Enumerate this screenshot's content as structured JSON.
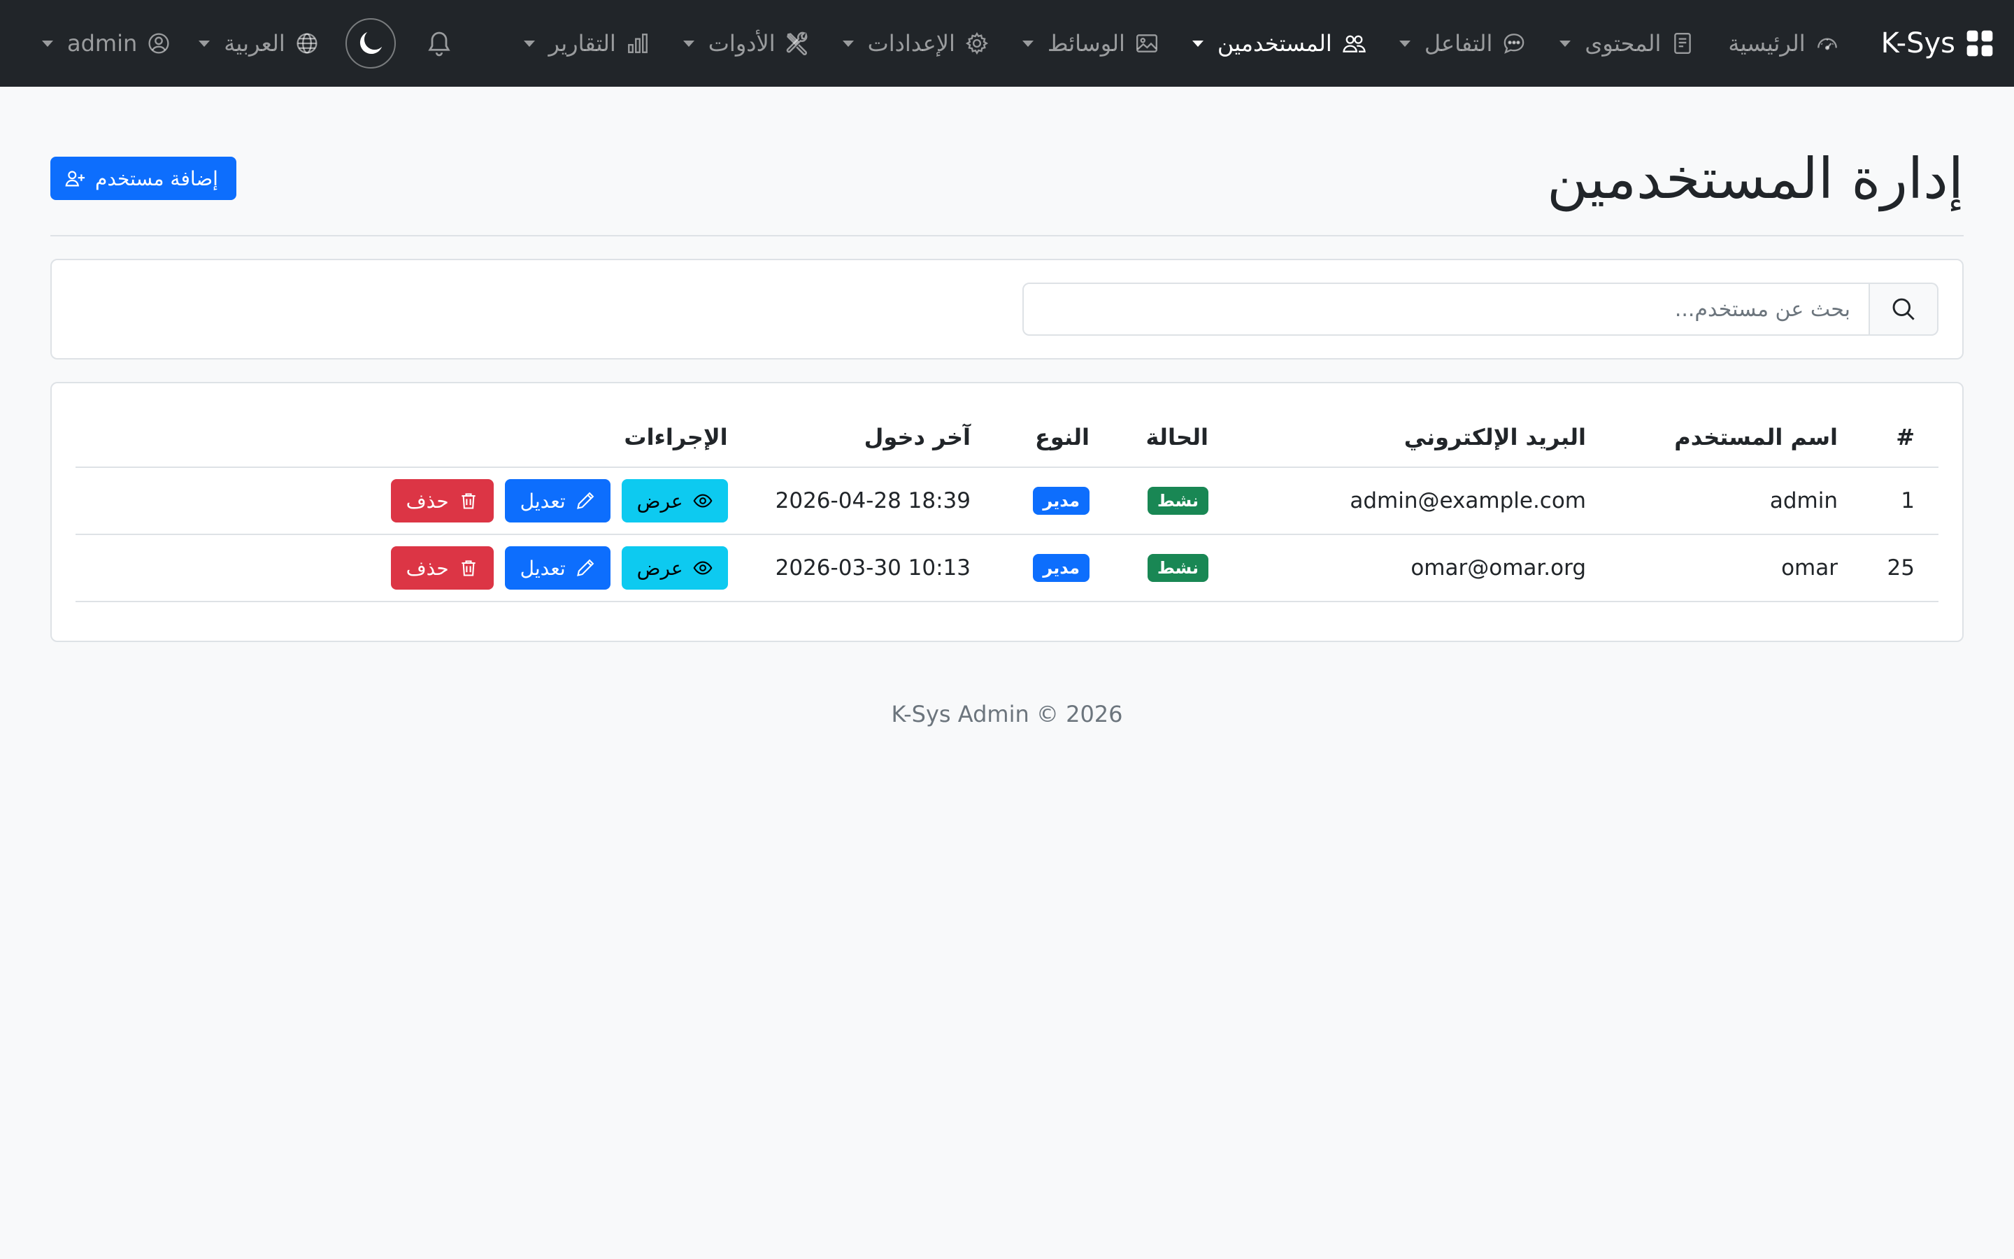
{
  "navbar": {
    "brand": "K-Sys",
    "items": [
      {
        "label": "الرئيسية",
        "icon": "speedometer-icon",
        "dropdown": false
      },
      {
        "label": "المحتوى",
        "icon": "file-text-icon",
        "dropdown": true
      },
      {
        "label": "التفاعل",
        "icon": "chat-icon",
        "dropdown": true
      },
      {
        "label": "المستخدمين",
        "icon": "people-icon",
        "dropdown": true,
        "active": true
      },
      {
        "label": "الوسائط",
        "icon": "image-icon",
        "dropdown": true
      },
      {
        "label": "الإعدادات",
        "icon": "gear-icon",
        "dropdown": true
      },
      {
        "label": "الأدوات",
        "icon": "tools-icon",
        "dropdown": true
      },
      {
        "label": "التقارير",
        "icon": "bar-chart-icon",
        "dropdown": true
      }
    ],
    "language": "العربية",
    "user": "admin"
  },
  "page": {
    "title": "إدارة المستخدمين",
    "add_button": "إضافة مستخدم"
  },
  "search": {
    "placeholder": "بحث عن مستخدم..."
  },
  "table": {
    "headers": {
      "id": "#",
      "username": "اسم المستخدم",
      "email": "البريد الإلكتروني",
      "status": "الحالة",
      "type": "النوع",
      "last_login": "آخر دخول",
      "actions": "الإجراءات"
    },
    "rows": [
      {
        "id": "1",
        "username": "admin",
        "email": "admin@example.com",
        "status": "نشط",
        "type": "مدير",
        "last_login": "2026-04-28 18:39"
      },
      {
        "id": "25",
        "username": "omar",
        "email": "omar@omar.org",
        "status": "نشط",
        "type": "مدير",
        "last_login": "2026-03-30 10:13"
      }
    ],
    "actions": {
      "view": "عرض",
      "edit": "تعديل",
      "delete": "حذف"
    }
  },
  "colors": {
    "navbar": "#212529",
    "primary": "#0d6efd",
    "info": "#0dcaf0",
    "danger": "#dc3545",
    "success": "#198754"
  },
  "footer": "K-Sys Admin © 2026"
}
